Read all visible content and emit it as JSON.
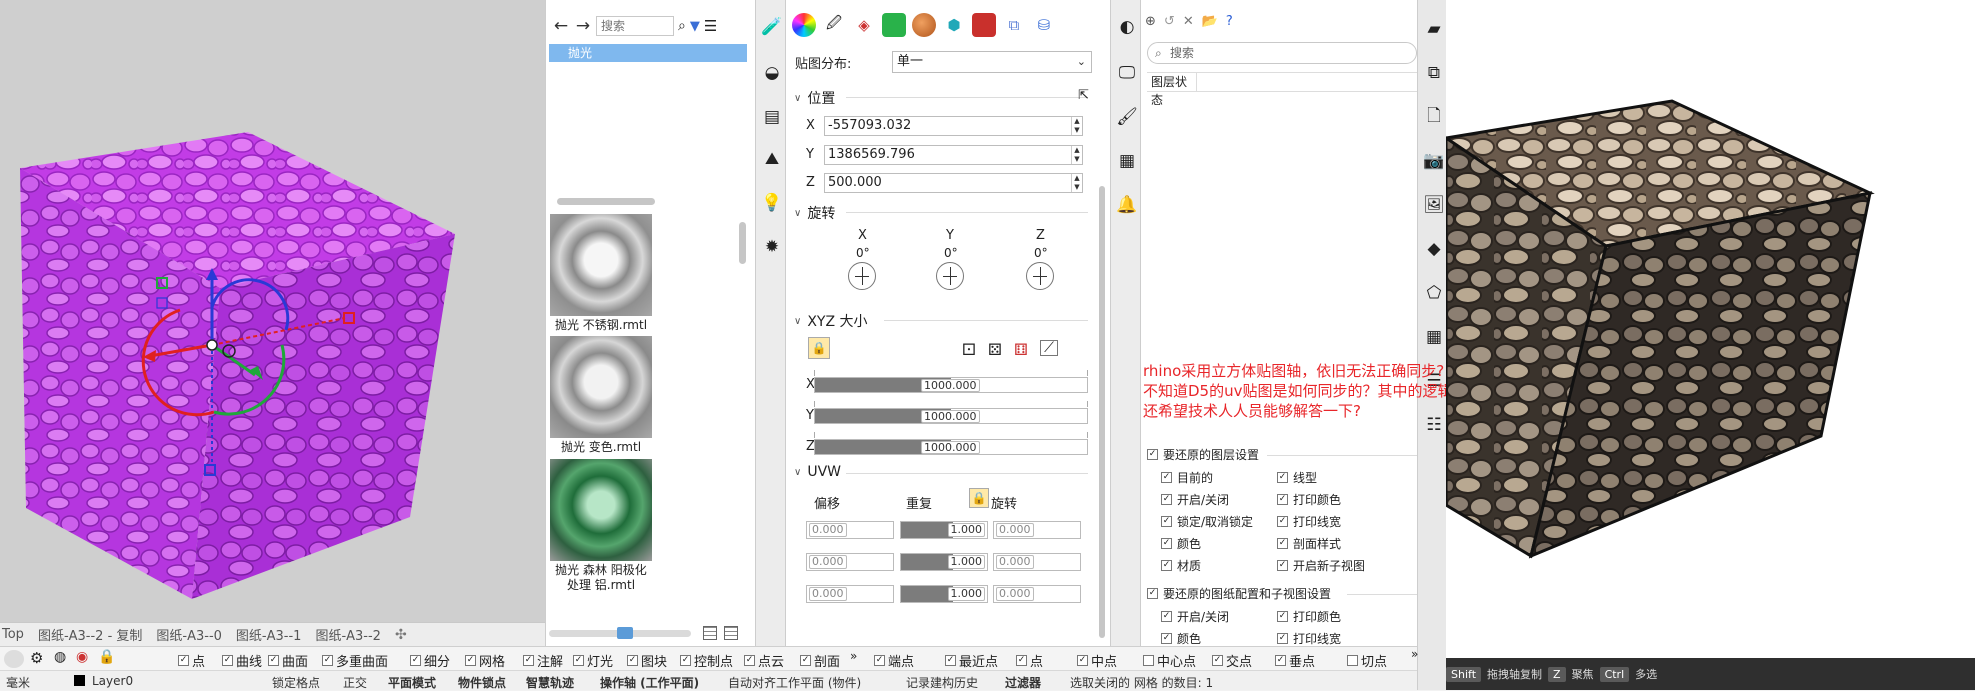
{
  "layout_tabs": {
    "items": [
      "Top",
      "图纸-A3--2 - 复制",
      "图纸-A3--0",
      "图纸-A3--1",
      "图纸-A3--2"
    ],
    "add_glyph": "✣"
  },
  "material_panel": {
    "search_placeholder": "搜索",
    "selected_item": "抛光",
    "thumbnails": [
      {
        "label": "抛光 不锈钢.rmtl"
      },
      {
        "label": "抛光 变色.rmtl"
      },
      {
        "label": "抛光 森林 阳极化处理 铝.rmtl"
      }
    ]
  },
  "mapping_panel": {
    "distribution_label": "贴图分布:",
    "distribution_value": "单一",
    "position_section": "位置",
    "x_label": "X",
    "x_value": "-557093.032",
    "y_label": "Y",
    "y_value": "1386569.796",
    "z_label": "Z",
    "z_value": "500.000",
    "rotation_section": "旋转",
    "rot_axes": [
      {
        "axis": "X",
        "value": "0°"
      },
      {
        "axis": "Y",
        "value": "0°"
      },
      {
        "axis": "Z",
        "value": "0°"
      }
    ],
    "size_section": "XYZ 大小",
    "size_rows": [
      {
        "label": "X",
        "value": "1000.000",
        "fill": 0.5
      },
      {
        "label": "Y",
        "value": "1000.000",
        "fill": 0.5
      },
      {
        "label": "Z",
        "value": "1000.000",
        "fill": 0.5
      }
    ],
    "uvw_section": "UVW",
    "offset_label": "偏移",
    "repeat_label": "重复",
    "rotate_label": "旋转",
    "uvw_rows": [
      {
        "offset": "0.000",
        "repeat": "1.000",
        "rotate": "0.000"
      },
      {
        "offset": "0.000",
        "repeat": "1.000",
        "rotate": "0.000"
      },
      {
        "offset": "0.000",
        "repeat": "1.000",
        "rotate": "0.000"
      }
    ]
  },
  "layer_panel": {
    "search_placeholder": "搜索",
    "header_col": "图层状态",
    "annotation_lines": [
      "rhino采用立方体贴图轴，依旧无法正确同步?",
      "不知道D5的uv贴图是如何同步的？其中的逻辑是什么？",
      "还希望技术人人员能够解答一下?"
    ],
    "layer_settings_title": "要还原的图层设置",
    "layer_settings": [
      [
        "目前的",
        "线型"
      ],
      [
        "开启/关闭",
        "打印颜色"
      ],
      [
        "锁定/取消锁定",
        "打印线宽"
      ],
      [
        "颜色",
        "剖面样式"
      ],
      [
        "材质",
        "开启新子视图"
      ]
    ],
    "layout_settings_title": "要还原的图纸配置和子视图设置",
    "layout_settings": [
      [
        "开启/关闭",
        "打印颜色"
      ],
      [
        "颜色",
        "打印线宽"
      ]
    ]
  },
  "render_status": {
    "key1": "Shift",
    "action1": "拖拽轴复制",
    "key2": "Z",
    "action2": "聚焦",
    "key3": "Ctrl",
    "action3": "多选"
  },
  "osnap_bar": {
    "left_items": [
      "点",
      "曲线",
      "曲面",
      "多重曲面",
      "细分",
      "网格",
      "注解",
      "灯光",
      "图块",
      "控制点",
      "点云",
      "剖面"
    ],
    "right_items_checked": [
      "端点",
      "最近点",
      "点",
      "中点"
    ],
    "right_items_unchecked_1": "中心点",
    "right_items_checked_2": [
      "交点",
      "垂点"
    ],
    "right_items_unchecked_2": "切点",
    "overflow": "»"
  },
  "status_bar": {
    "unit": "毫米",
    "layer": "Layer0",
    "items": [
      "锁定格点",
      "正交",
      "平面模式",
      "物件锁点",
      "智慧轨迹",
      "操作轴 (工作平面)",
      "自动对齐工作平面 (物件)",
      "记录建构历史",
      "过滤器"
    ],
    "bold_flags": [
      false,
      false,
      true,
      true,
      true,
      true,
      false,
      false,
      true
    ],
    "selection_info": "选取关闭的 网格 的数目: 1"
  }
}
